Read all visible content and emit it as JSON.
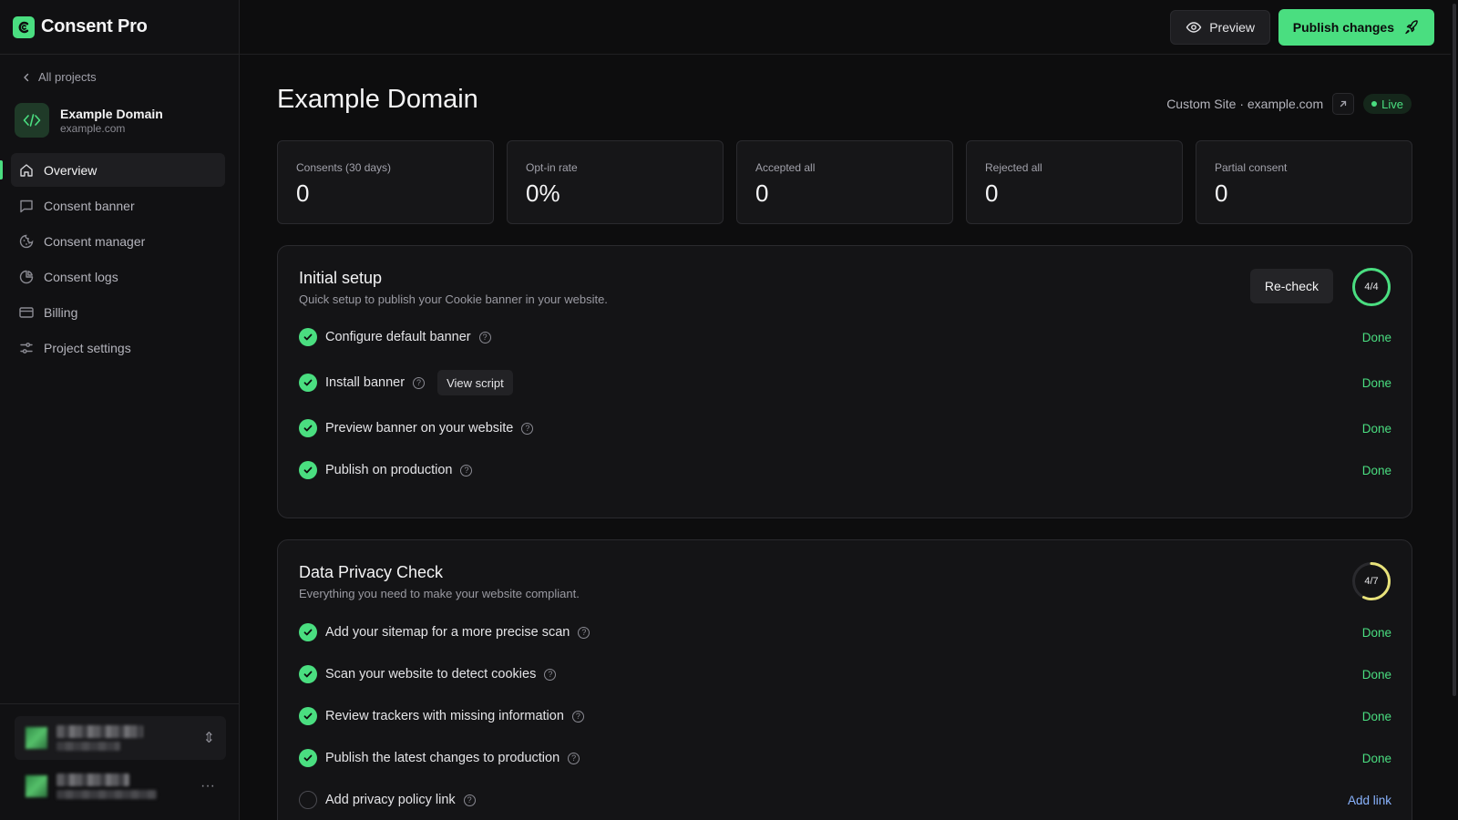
{
  "app": {
    "name": "Consent Pro",
    "accent": "#4ade80"
  },
  "sidebar": {
    "back_label": "All projects",
    "project": {
      "name": "Example Domain",
      "domain": "example.com"
    },
    "items": [
      {
        "label": "Overview",
        "icon": "home-icon",
        "active": true
      },
      {
        "label": "Consent banner",
        "icon": "message-square-icon",
        "active": false
      },
      {
        "label": "Consent manager",
        "icon": "cookie-icon",
        "active": false
      },
      {
        "label": "Consent logs",
        "icon": "pie-chart-icon",
        "active": false
      },
      {
        "label": "Billing",
        "icon": "credit-card-icon",
        "active": false
      },
      {
        "label": "Project settings",
        "icon": "sliders-icon",
        "active": false
      }
    ]
  },
  "topbar": {
    "preview_label": "Preview",
    "publish_label": "Publish changes"
  },
  "header": {
    "title": "Example Domain",
    "site_meta": "Custom Site · example.com",
    "status": "Live"
  },
  "stats": [
    {
      "label": "Consents (30 days)",
      "value": "0"
    },
    {
      "label": "Opt-in rate",
      "value": "0%"
    },
    {
      "label": "Accepted all",
      "value": "0"
    },
    {
      "label": "Rejected all",
      "value": "0"
    },
    {
      "label": "Partial consent",
      "value": "0"
    }
  ],
  "setup": {
    "title": "Initial setup",
    "subtitle": "Quick setup to publish your Cookie banner in your website.",
    "recheck_label": "Re-check",
    "progress": "4/4",
    "progress_fraction": 1.0,
    "view_script_label": "View script",
    "items": [
      {
        "label": "Configure default banner",
        "status": "Done",
        "done": true
      },
      {
        "label": "Install banner",
        "status": "Done",
        "done": true
      },
      {
        "label": "Preview banner on your website",
        "status": "Done",
        "done": true
      },
      {
        "label": "Publish on production",
        "status": "Done",
        "done": true
      }
    ]
  },
  "privacy": {
    "title": "Data Privacy Check",
    "subtitle": "Everything you need to make your website compliant.",
    "progress": "4/7",
    "progress_fraction": 0.571,
    "items": [
      {
        "label": "Add your sitemap for a more precise scan",
        "status": "Done",
        "done": true
      },
      {
        "label": "Scan your website to detect cookies",
        "status": "Done",
        "done": true
      },
      {
        "label": "Review trackers with missing information",
        "status": "Done",
        "done": true
      },
      {
        "label": "Publish the latest changes to production",
        "status": "Done",
        "done": true
      },
      {
        "label": "Add privacy policy link",
        "status": "Add link",
        "done": false
      }
    ]
  }
}
